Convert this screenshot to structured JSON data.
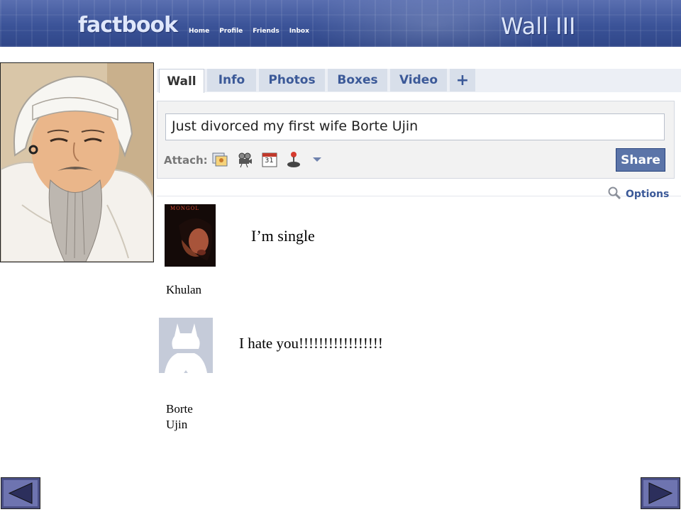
{
  "header": {
    "logo": "factbook",
    "nav": [
      "Home",
      "Profile",
      "Friends",
      "Inbox"
    ],
    "title": "Wall III"
  },
  "tabs": [
    {
      "label": "Wall",
      "active": true
    },
    {
      "label": "Info",
      "active": false
    },
    {
      "label": "Photos",
      "active": false
    },
    {
      "label": "Boxes",
      "active": false
    },
    {
      "label": "Video",
      "active": false
    },
    {
      "label": "+",
      "active": false
    }
  ],
  "composer": {
    "status_value": "Just divorced my first wife Borte Ujin",
    "attach_label": "Attach:",
    "attach_icons": [
      "photo-icon",
      "video-camera-icon",
      "calendar-icon",
      "joystick-icon",
      "dropdown-arrow-icon"
    ],
    "share_label": "Share"
  },
  "options_label": "Options",
  "posts": [
    {
      "author": "Khulan",
      "text": "I’m single"
    },
    {
      "author": "Borte Ujin",
      "text": "I hate you!!!!!!!!!!!!!!!!!"
    }
  ],
  "avatar1_caption": "MONGOL",
  "calendar_number": "31",
  "colors": {
    "brand": "#3b5998",
    "banner": "#3b5398",
    "share": "#5b74a8"
  }
}
